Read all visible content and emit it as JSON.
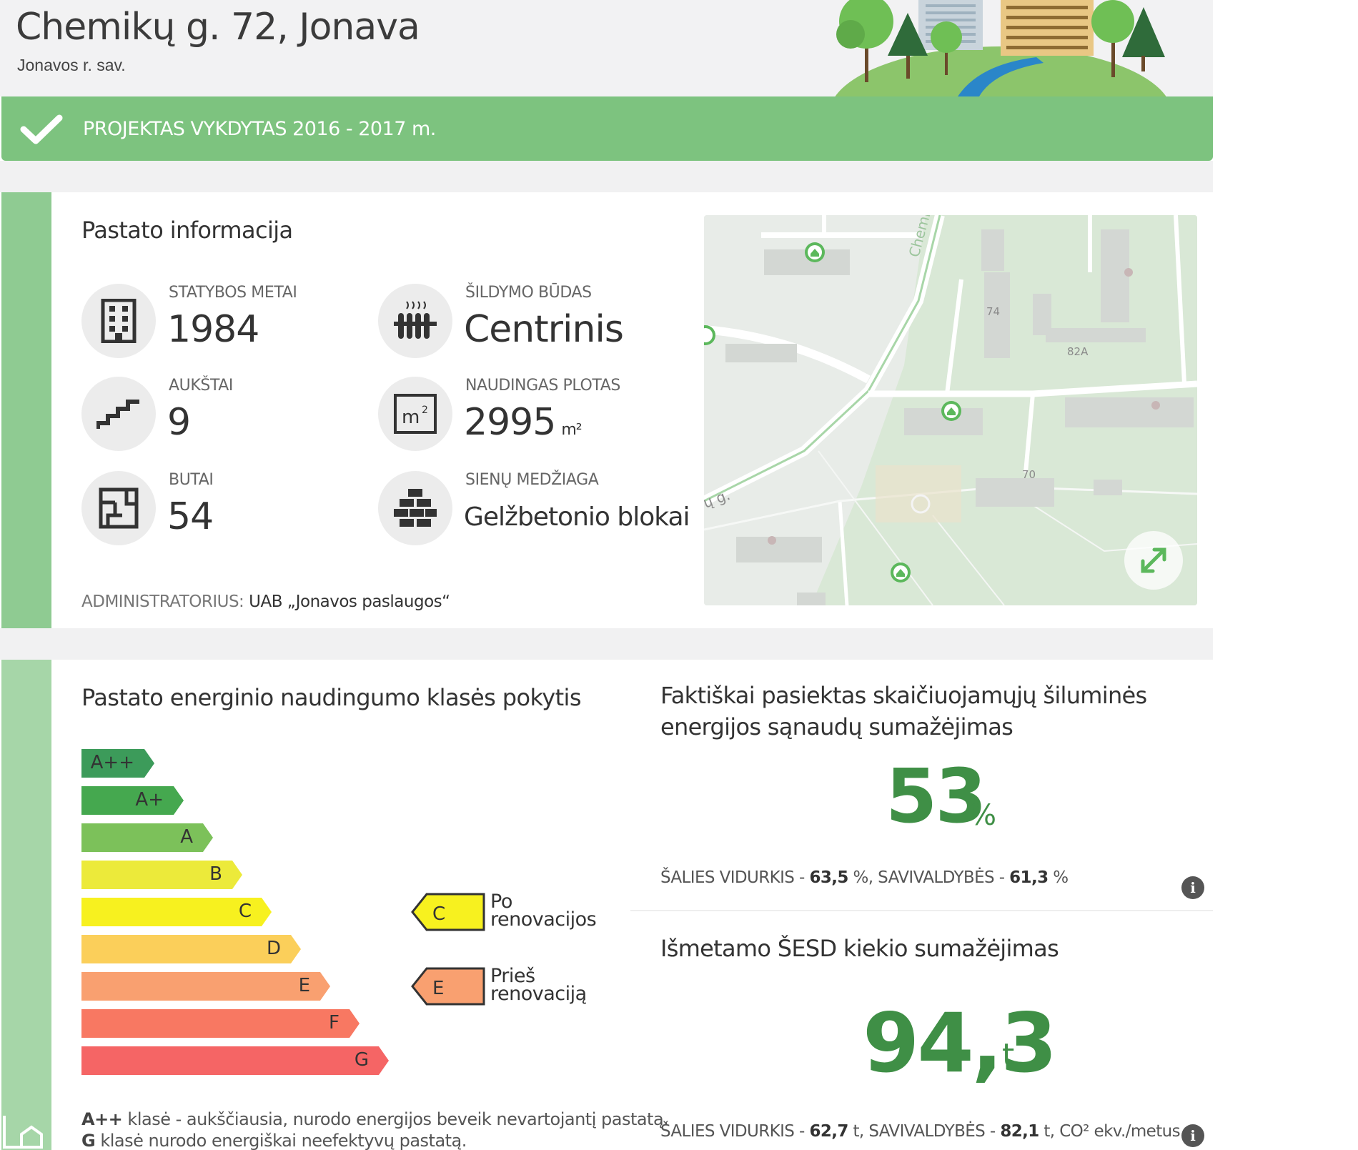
{
  "header": {
    "title": "Chemikų g. 72, Jonava",
    "subtitle": "Jonavos r. sav."
  },
  "banner": {
    "text": "PROJEKTAS VYKDYTAS 2016 - 2017 m.",
    "icon": "check-icon",
    "color": "#7dc37f"
  },
  "building": {
    "title": "Pastato informacija",
    "items": [
      {
        "label": "STATYBOS METAI",
        "value": "1984",
        "icon": "building-icon"
      },
      {
        "label": "ŠILDYMO BŪDAS",
        "value": "Centrinis",
        "icon": "radiator-icon"
      },
      {
        "label": "AUKŠTAI",
        "value": "9",
        "icon": "stairs-icon"
      },
      {
        "label": "NAUDINGAS PLOTAS",
        "value": "2995",
        "unit": "m²",
        "icon": "area-icon"
      },
      {
        "label": "BUTAI",
        "value": "54",
        "icon": "floorplan-icon"
      },
      {
        "label": "SIENŲ MEDŽIAGA",
        "value": "Gelžbetonio blokai",
        "icon": "bricks-icon"
      }
    ],
    "admin_label": "ADMINISTRATORIUS:",
    "admin_value": "UAB „Jonavos paslaugos“"
  },
  "map": {
    "street_label": "Chemi",
    "street_label_2": "ų g.",
    "house_labels": [
      "74",
      "82A",
      "70"
    ],
    "expand_icon": "expand-icon"
  },
  "energy": {
    "title": "Pastato energinio naudingumo klasės pokytis",
    "classes": [
      {
        "name": "A++",
        "color": "#3c9b5a"
      },
      {
        "name": "A+",
        "color": "#45a84f"
      },
      {
        "name": "A",
        "color": "#7cc15a"
      },
      {
        "name": "B",
        "color": "#ecea3a"
      },
      {
        "name": "C",
        "color": "#f7f11f"
      },
      {
        "name": "D",
        "color": "#fbcf5a"
      },
      {
        "name": "E",
        "color": "#f9a070"
      },
      {
        "name": "F",
        "color": "#f87862"
      },
      {
        "name": "G",
        "color": "#f56565"
      }
    ],
    "after": {
      "class": "C",
      "label_line1": "Po",
      "label_line2": "renovacijos"
    },
    "before": {
      "class": "E",
      "label_line1": "Prieš",
      "label_line2": "renovaciją"
    },
    "legend_line1_bold": "A++",
    "legend_line1": " klasė - aukščiausia, nurodo energijos beveik nevartojantį pastatą.",
    "legend_line2_bold": "G",
    "legend_line2": " klasė nurodo energiškai neefektyvų pastatą."
  },
  "heat": {
    "title": "Faktiškai pasiektas skaičiuojamųjų šiluminės energijos sąnaudų sumažėjimas",
    "value": "53",
    "unit": "%",
    "note_prefix": "ŠALIES VIDURKIS - ",
    "note_country": "63,5",
    "note_mid": " %, SAVIVALDYBĖS - ",
    "note_municipality": "61,3",
    "note_suffix": " %"
  },
  "ghg": {
    "title": "Išmetamo ŠESD kiekio sumažėjimas",
    "value": "94,3",
    "unit": "t",
    "note_prefix": "ŠALIES VIDURKIS - ",
    "note_country": "62,7",
    "note_mid": " t, SAVIVALDYBĖS - ",
    "note_municipality": "82,1",
    "note_suffix": " t, CO² ekv./metus."
  },
  "accent_color": "#3f8f46"
}
